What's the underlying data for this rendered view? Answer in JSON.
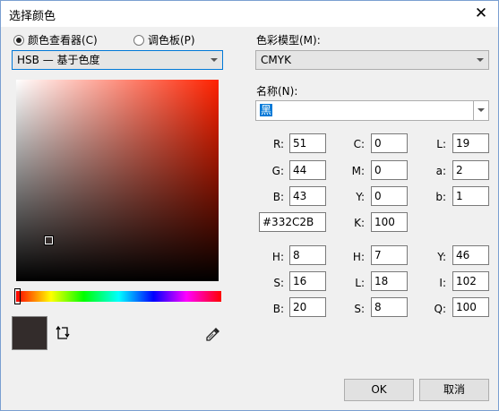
{
  "window": {
    "title": "选择颜色",
    "close_label": "✕"
  },
  "mode_tabs": [
    {
      "label": "颜色查看器(C)",
      "selected": true
    },
    {
      "label": "调色板(P)",
      "selected": false
    }
  ],
  "viewer_select": {
    "value": "HSB — 基于色度"
  },
  "color_model": {
    "label": "色彩模型(M):",
    "value": "CMYK"
  },
  "name": {
    "label": "名称(N):",
    "value": "黑"
  },
  "current_color": "#332C2B",
  "rgb": {
    "r_label": "R:",
    "r": "51",
    "g_label": "G:",
    "g": "44",
    "b_label": "B:",
    "b": "43"
  },
  "hex_value": "#332C2B",
  "cmyk": {
    "c_label": "C:",
    "c": "0",
    "m_label": "M:",
    "m": "0",
    "y_label": "Y:",
    "y": "0",
    "k_label": "K:",
    "k": "100"
  },
  "lab": {
    "l_label": "L:",
    "l": "19",
    "a_label": "a:",
    "a": "2",
    "b_label": "b:",
    "b": "1"
  },
  "hsb": {
    "h_label": "H:",
    "h": "8",
    "s_label": "S:",
    "s": "16",
    "b_label": "B:",
    "b": "20"
  },
  "hls": {
    "h_label": "H:",
    "h": "7",
    "l_label": "L:",
    "l": "18",
    "s_label": "S:",
    "s": "8"
  },
  "yiq": {
    "y_label": "Y:",
    "y": "46",
    "i_label": "I:",
    "i": "102",
    "q_label": "Q:",
    "q": "100"
  },
  "buttons": {
    "ok": "OK",
    "cancel": "取消"
  },
  "icons": {
    "close": "close-icon",
    "swap": "swap-icon",
    "eyedropper": "eyedropper-icon"
  }
}
